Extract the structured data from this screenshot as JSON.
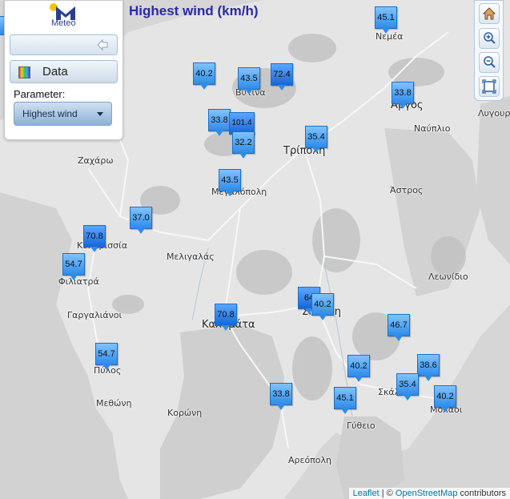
{
  "title": "Highest wind (km/h)",
  "panel": {
    "logo_text": "Meteo",
    "data_label": "Data",
    "parameter_label": "Parameter:",
    "parameter_value": "Highest wind"
  },
  "places": [
    {
      "name": "Νεμέα"
    },
    {
      "name": "Βυτίνα"
    },
    {
      "name": "Άργος"
    },
    {
      "name": "Ναύπλιο"
    },
    {
      "name": "Λυγουριό"
    },
    {
      "name": "Τρίπολη"
    },
    {
      "name": "Ζαχάρω"
    },
    {
      "name": "Μεγαλόπολη"
    },
    {
      "name": "Άστρος"
    },
    {
      "name": "Κυπαρισσία"
    },
    {
      "name": "Μελιγαλάς"
    },
    {
      "name": "Φιλιατρά"
    },
    {
      "name": "Λεωνίδιο"
    },
    {
      "name": "Γαργαλιάνοι"
    },
    {
      "name": "Καλαμάτα"
    },
    {
      "name": "Σπάρτη"
    },
    {
      "name": "Πύλος"
    },
    {
      "name": "Σκάλα"
    },
    {
      "name": "Μεθώνη"
    },
    {
      "name": "Κορώνη"
    },
    {
      "name": "Μολάοι"
    },
    {
      "name": "Γύθειο"
    },
    {
      "name": "Αρεόπολη"
    }
  ],
  "markers": [
    {
      "value": "45.1"
    },
    {
      "value": "40.2"
    },
    {
      "value": "43.5"
    },
    {
      "value": "72.4"
    },
    {
      "value": "33.8"
    },
    {
      "value": "33.8"
    },
    {
      "value": "101.4"
    },
    {
      "value": "32.2"
    },
    {
      "value": "35.4"
    },
    {
      "value": "43.5"
    },
    {
      "value": "37.0"
    },
    {
      "value": "70.8"
    },
    {
      "value": "54.7"
    },
    {
      "value": "64"
    },
    {
      "value": "40.2"
    },
    {
      "value": "70.8"
    },
    {
      "value": "46.7"
    },
    {
      "value": "54.7"
    },
    {
      "value": "40.2"
    },
    {
      "value": "38.6"
    },
    {
      "value": "35.4"
    },
    {
      "value": "40.2"
    },
    {
      "value": "33.8"
    },
    {
      "value": "45.1"
    }
  ],
  "attribution": {
    "leaflet": "Leaflet",
    "separator": " | © ",
    "osm": "OpenStreetMap",
    "suffix": " contributors"
  },
  "colors": {
    "title": "#2a2aa8",
    "marker": "#2f8be8",
    "land": "#dcdcdc",
    "sea": "#d0d0d0"
  }
}
